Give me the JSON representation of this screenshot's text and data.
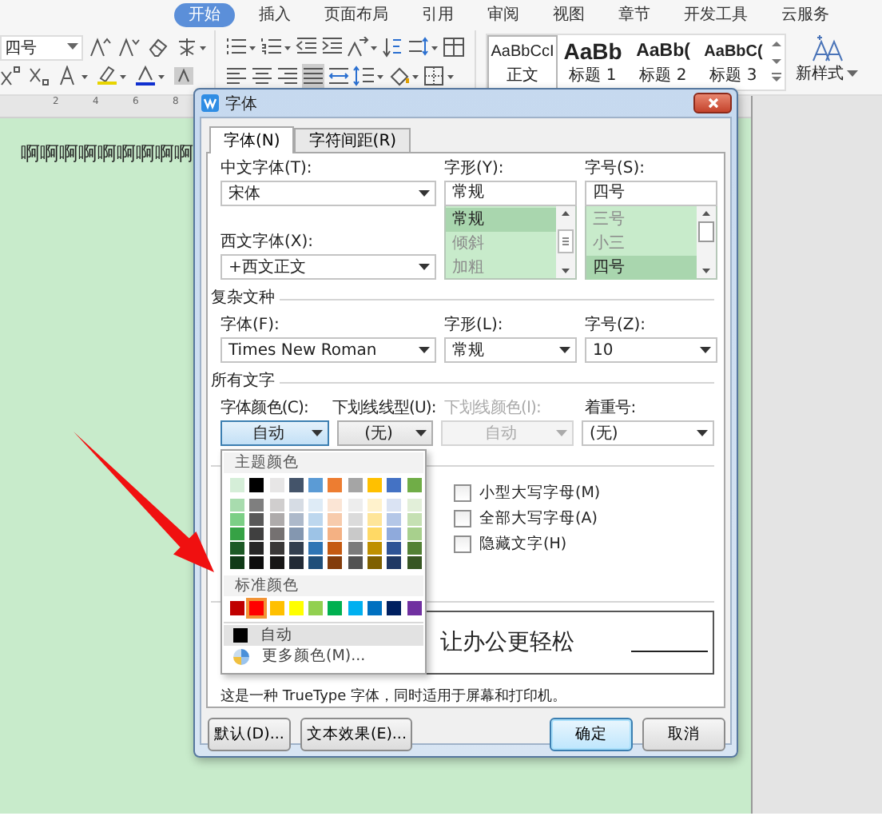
{
  "ribbon": {
    "tabs": [
      {
        "label": "开始",
        "selected": true
      },
      {
        "label": "插入",
        "selected": false
      },
      {
        "label": "页面布局",
        "selected": false
      },
      {
        "label": "引用",
        "selected": false
      },
      {
        "label": "审阅",
        "selected": false
      },
      {
        "label": "视图",
        "selected": false
      },
      {
        "label": "章节",
        "selected": false
      },
      {
        "label": "开发工具",
        "selected": false
      },
      {
        "label": "云服务",
        "selected": false
      }
    ],
    "font_size": "四号",
    "alignment_buttons": [
      {
        "selected": false
      },
      {
        "selected": false
      },
      {
        "selected": false
      },
      {
        "selected": true
      },
      {
        "selected": false
      }
    ],
    "styles": [
      {
        "kind": "body",
        "preview": "AaBbCcI",
        "label": "正文",
        "selected": true
      },
      {
        "kind": "heading1",
        "preview": "AaBb",
        "label": "标题 1",
        "selected": false
      },
      {
        "kind": "heading2",
        "preview": "AaBb(",
        "label": "标题 2",
        "selected": false
      },
      {
        "kind": "heading3",
        "preview": "AaBbC(",
        "label": "标题 3",
        "selected": false
      }
    ],
    "new_style": "新样式"
  },
  "ruler": {
    "ticks": [
      "2",
      "4",
      "6",
      "8"
    ]
  },
  "document": {
    "text": "啊啊啊啊啊啊啊啊啊"
  },
  "dialog": {
    "title": "字体",
    "tabs": [
      {
        "label": "字体(N)",
        "selected": true
      },
      {
        "label": "字符间距(R)",
        "selected": false
      }
    ],
    "chinese_font": {
      "label": "中文字体(T):",
      "value": "宋体"
    },
    "western_font": {
      "label": "西文字体(X):",
      "value": "+西文正文"
    },
    "style": {
      "label": "字形(Y):",
      "value": "常规",
      "options": [
        {
          "label": "常规",
          "selected": true
        },
        {
          "label": "倾斜",
          "selected": false
        },
        {
          "label": "加粗",
          "selected": false
        }
      ]
    },
    "size": {
      "label": "字号(S):",
      "value": "四号",
      "options": [
        {
          "label": "三号",
          "selected": false
        },
        {
          "label": "小三",
          "selected": false
        },
        {
          "label": "四号",
          "selected": true
        }
      ]
    },
    "complex_section": "复杂文种",
    "complex_font": {
      "label": "字体(F):",
      "value": "Times New Roman"
    },
    "complex_style": {
      "label": "字形(L):",
      "value": "常规"
    },
    "complex_size": {
      "label": "字号(Z):",
      "value": "10"
    },
    "all_text_section": "所有文字",
    "all_text_fields": [
      {
        "kind": "picker",
        "label": "字体颜色(C):",
        "value": "自动",
        "disabled": false,
        "focused": true
      },
      {
        "kind": "picker",
        "label": "下划线线型(U):",
        "value": "(无)",
        "disabled": false,
        "focused": false
      },
      {
        "kind": "picker",
        "label": "下划线颜色(I):",
        "value": "自动",
        "disabled": true,
        "focused": false
      },
      {
        "kind": "list",
        "label": "着重号:",
        "value": "(无)",
        "disabled": false,
        "focused": false
      }
    ],
    "effects": [
      {
        "label": "小型大写字母(M)",
        "checked": false
      },
      {
        "label": "全部大写字母(A)",
        "checked": false
      },
      {
        "label": "隐藏文字(H)",
        "checked": false
      }
    ],
    "preview_text": "让办公更轻松",
    "description": "这是一种 TrueType 字体，同时适用于屏幕和打印机。",
    "left_buttons": [
      {
        "label": "默认(D)...",
        "default": false
      },
      {
        "label": "文本效果(E)...",
        "default": false
      }
    ],
    "right_buttons": [
      {
        "label": "确定",
        "default": true
      },
      {
        "label": "取消",
        "default": false
      }
    ]
  },
  "color_menu": {
    "theme_title": "主题颜色",
    "theme_colors": [
      {
        "color": "#d5eed8",
        "shades": [
          {
            "color": "#a8dcae"
          },
          {
            "color": "#7ccf86"
          },
          {
            "color": "#36a245"
          },
          {
            "color": "#1d5a26"
          },
          {
            "color": "#103a17"
          }
        ]
      },
      {
        "color": "#000000",
        "shades": [
          {
            "color": "#7f7f7f"
          },
          {
            "color": "#595959"
          },
          {
            "color": "#404040"
          },
          {
            "color": "#262626"
          },
          {
            "color": "#0d0d0d"
          }
        ]
      },
      {
        "color": "#e7e6e6",
        "shades": [
          {
            "color": "#d0cece"
          },
          {
            "color": "#aeabab"
          },
          {
            "color": "#757171"
          },
          {
            "color": "#3a3838"
          },
          {
            "color": "#171616"
          }
        ]
      },
      {
        "color": "#44546a",
        "shades": [
          {
            "color": "#d6dce4"
          },
          {
            "color": "#adb9ca"
          },
          {
            "color": "#8497b0"
          },
          {
            "color": "#333f4f"
          },
          {
            "color": "#222a35"
          }
        ]
      },
      {
        "color": "#5b9bd5",
        "shades": [
          {
            "color": "#deebf6"
          },
          {
            "color": "#bdd7ee"
          },
          {
            "color": "#9dc3e6"
          },
          {
            "color": "#2e75b5"
          },
          {
            "color": "#1f4e79"
          }
        ]
      },
      {
        "color": "#ed7d31",
        "shades": [
          {
            "color": "#fbe5d5"
          },
          {
            "color": "#f7cbac"
          },
          {
            "color": "#f4b183"
          },
          {
            "color": "#c55a11"
          },
          {
            "color": "#833c0b"
          }
        ]
      },
      {
        "color": "#a5a5a5",
        "shades": [
          {
            "color": "#ededed"
          },
          {
            "color": "#dbdbdb"
          },
          {
            "color": "#c9c9c9"
          },
          {
            "color": "#7b7b7b"
          },
          {
            "color": "#525252"
          }
        ]
      },
      {
        "color": "#ffc000",
        "shades": [
          {
            "color": "#fff2cc"
          },
          {
            "color": "#fee599"
          },
          {
            "color": "#ffd965"
          },
          {
            "color": "#bf9000"
          },
          {
            "color": "#7f6000"
          }
        ]
      },
      {
        "color": "#4472c4",
        "shades": [
          {
            "color": "#dae3f3"
          },
          {
            "color": "#b4c7e7"
          },
          {
            "color": "#8faadc"
          },
          {
            "color": "#2f5496"
          },
          {
            "color": "#1f3864"
          }
        ]
      },
      {
        "color": "#70ad47",
        "shades": [
          {
            "color": "#e2efd9"
          },
          {
            "color": "#c5e0b3"
          },
          {
            "color": "#a8d08d"
          },
          {
            "color": "#538135"
          },
          {
            "color": "#375623"
          }
        ]
      }
    ],
    "standard_title": "标准颜色",
    "standard_colors": [
      {
        "color": "#c00000",
        "selected": false
      },
      {
        "color": "#ff0000",
        "selected": true
      },
      {
        "color": "#ffc000",
        "selected": false
      },
      {
        "color": "#ffff00",
        "selected": false
      },
      {
        "color": "#92d050",
        "selected": false
      },
      {
        "color": "#00b050",
        "selected": false
      },
      {
        "color": "#00b0f0",
        "selected": false
      },
      {
        "color": "#0070c0",
        "selected": false
      },
      {
        "color": "#002060",
        "selected": false
      },
      {
        "color": "#7030a0",
        "selected": false
      }
    ],
    "items": [
      {
        "kind": "auto",
        "label": "自动",
        "selected": true
      },
      {
        "kind": "more",
        "label": "更多颜色(M)...",
        "selected": false
      }
    ]
  }
}
